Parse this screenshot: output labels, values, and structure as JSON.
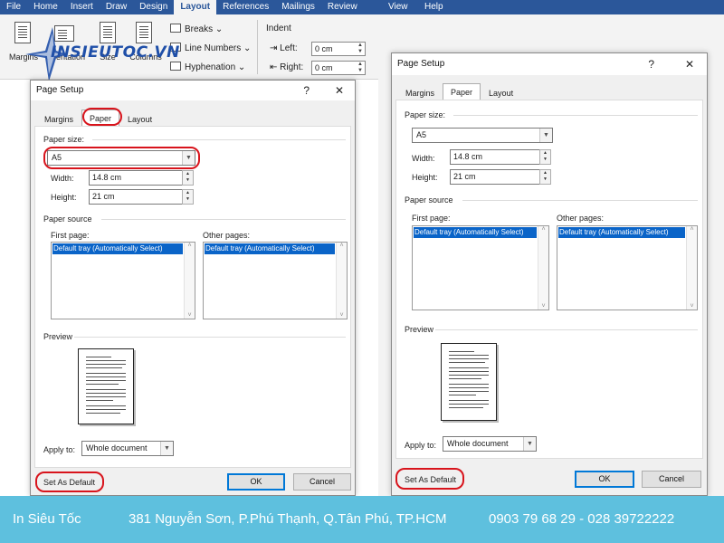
{
  "ribbon": {
    "tabs": [
      "File",
      "Home",
      "Insert",
      "Draw",
      "Design",
      "Layout",
      "References",
      "Mailings",
      "Review"
    ],
    "active_tab": "Layout",
    "buttons": {
      "margins": "Margins",
      "orientation": "Orientation",
      "size": "Size",
      "columns": "Columns"
    },
    "page_setup_items": {
      "breaks": "Breaks",
      "line_numbers": "Line Numbers",
      "hyphenation": "Hyphenation"
    },
    "indent": {
      "heading": "Indent",
      "left_label": "Left:",
      "left_value": "0 cm",
      "right_label": "Right:",
      "right_value": "0 cm"
    },
    "extra_tabs": [
      "View",
      "Help"
    ]
  },
  "watermark": {
    "text": "INSIEUTOC.VN"
  },
  "left_dialog": {
    "title": "Page Setup",
    "help_glyph": "?",
    "close_glyph": "✕",
    "tabs": [
      "Margins",
      "Paper",
      "Layout"
    ],
    "active_tab": "Paper",
    "paper_size_label": "Paper size:",
    "paper_size_value": "A5",
    "width_label": "Width:",
    "width_value": "14.8 cm",
    "height_label": "Height:",
    "height_value": "21 cm",
    "paper_source_label": "Paper source",
    "first_page_label": "First page:",
    "first_page_item": "Default tray (Automatically Select)",
    "other_pages_label": "Other pages:",
    "other_pages_item": "Default tray (Automatically Select)",
    "preview_label": "Preview",
    "apply_to_label": "Apply to:",
    "apply_to_value": "Whole document",
    "set_default_label": "Set As Default",
    "ok_label": "OK",
    "cancel_label": "Cancel"
  },
  "right_dialog": {
    "title": "Page Setup",
    "help_glyph": "?",
    "close_glyph": "✕",
    "tabs": [
      "Margins",
      "Paper",
      "Layout"
    ],
    "active_tab": "Paper",
    "paper_size_label": "Paper size:",
    "paper_size_value": "A5",
    "width_label": "Width:",
    "width_value": "14.8 cm",
    "height_label": "Height:",
    "height_value": "21 cm",
    "paper_source_label": "Paper source",
    "first_page_label": "First page:",
    "first_page_item": "Default tray (Automatically Select)",
    "other_pages_label": "Other pages:",
    "other_pages_item": "Default tray (Automatically Select)",
    "preview_label": "Preview",
    "apply_to_label": "Apply to:",
    "apply_to_value": "Whole document",
    "set_default_label": "Set As Default",
    "ok_label": "OK",
    "cancel_label": "Cancel"
  },
  "footer": {
    "brand": "In Siêu Tốc",
    "address": "381 Nguyễn Sơn, P.Phú Thạnh, Q.Tân Phú, TP.HCM",
    "phones": "0903 79 68 29 - 028 39722222"
  },
  "colors": {
    "ribbon_blue": "#2b579a",
    "highlight_red": "#d8141c",
    "footer_bg": "#5ec0de",
    "selection_blue": "#0a64c8",
    "logo_blue": "#1f4fa8"
  },
  "icons": [
    "page-icon",
    "orientation-icon",
    "size-icon",
    "columns-icon",
    "breaks-icon",
    "line-numbers-icon",
    "hyphenation-icon",
    "indent-left-icon",
    "indent-right-icon",
    "dropdown-arrow-icon",
    "spin-up-icon",
    "spin-down-icon",
    "close-icon",
    "help-icon",
    "star-logo-icon"
  ]
}
